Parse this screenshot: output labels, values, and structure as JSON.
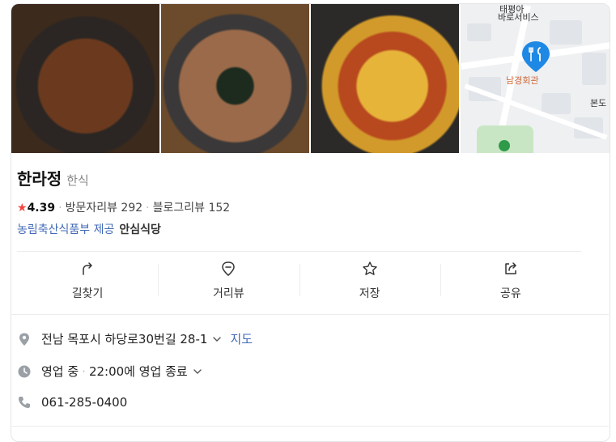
{
  "place": {
    "name": "한라정",
    "category": "한식",
    "rating": "4.39",
    "visitor_reviews_label": "방문자리뷰",
    "visitor_reviews_count": "292",
    "blog_reviews_label": "블로그리뷰",
    "blog_reviews_count": "152",
    "source_text": "농림축산식품부 제공",
    "badge_text": "안심식당"
  },
  "map": {
    "labels": [
      "바로서비스",
      "남경회관",
      "본도"
    ],
    "top_label": "태평아"
  },
  "actions": [
    {
      "label": "길찾기",
      "icon": "directions-icon"
    },
    {
      "label": "거리뷰",
      "icon": "street-view-icon"
    },
    {
      "label": "저장",
      "icon": "star-icon"
    },
    {
      "label": "공유",
      "icon": "share-icon"
    }
  ],
  "details": {
    "address": "전남 목포시 하당로30번길 28-1",
    "map_link": "지도",
    "status": "영업 중",
    "hours": "22:00에 영업 종료",
    "phone": "061-285-0400"
  },
  "colors": {
    "link": "#4169b8",
    "star": "#f5443b",
    "pin": "#1e88e5"
  }
}
